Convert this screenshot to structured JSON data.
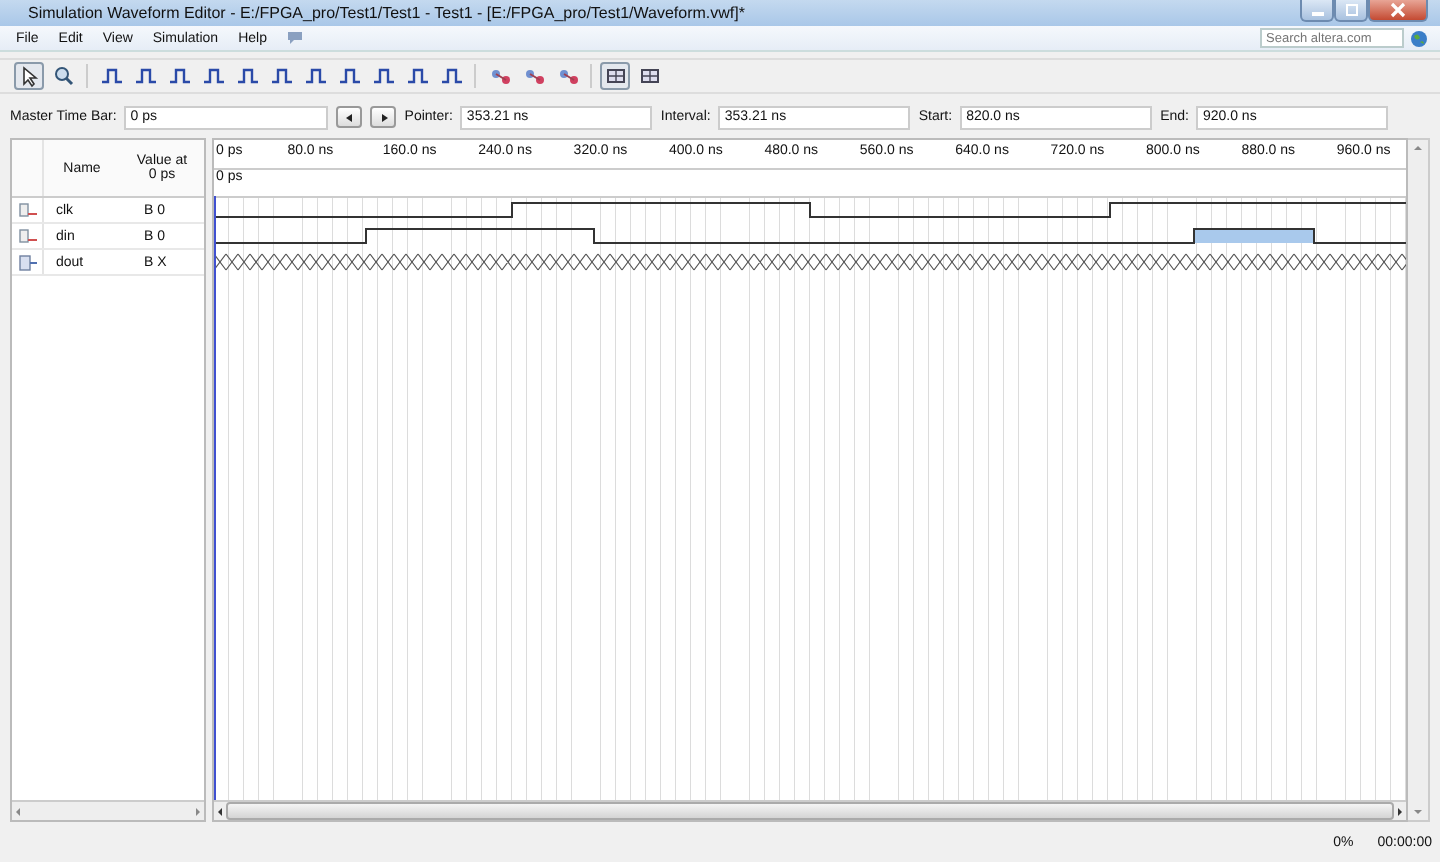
{
  "window": {
    "title": "Simulation Waveform Editor - E:/FPGA_pro/Test1/Test1 - Test1 - [E:/FPGA_pro/Test1/Waveform.vwf]*"
  },
  "menu": [
    "File",
    "Edit",
    "View",
    "Simulation",
    "Help"
  ],
  "search": {
    "placeholder": "Search altera.com"
  },
  "toolbar": [
    {
      "kind": "pointer",
      "pressed": true
    },
    {
      "kind": "zoom",
      "pressed": false
    },
    {
      "kind": "wave",
      "pressed": false
    },
    {
      "kind": "wave",
      "pressed": false
    },
    {
      "kind": "wave",
      "pressed": false
    },
    {
      "kind": "wave",
      "pressed": false
    },
    {
      "kind": "wave",
      "pressed": false
    },
    {
      "kind": "wave",
      "pressed": false
    },
    {
      "kind": "wave",
      "pressed": false
    },
    {
      "kind": "wave",
      "pressed": false
    },
    {
      "kind": "wave",
      "pressed": false
    },
    {
      "kind": "wave",
      "pressed": false
    },
    {
      "kind": "wave",
      "pressed": false
    },
    {
      "kind": "node",
      "pressed": false
    },
    {
      "kind": "node",
      "pressed": false
    },
    {
      "kind": "node",
      "pressed": false
    },
    {
      "kind": "grid",
      "pressed": true
    },
    {
      "kind": "grid",
      "pressed": false
    }
  ],
  "time_bar": {
    "master_label": "Master Time Bar:",
    "master_value": "0 ps",
    "fields": [
      {
        "label": "Pointer:",
        "value": "353.21 ns"
      },
      {
        "label": "Interval:",
        "value": "353.21 ns"
      },
      {
        "label": "Start:",
        "value": "820.0 ns"
      },
      {
        "label": "End:",
        "value": "920.0 ns"
      }
    ]
  },
  "columns": [
    "Name",
    "Value at\n0 ps"
  ],
  "ruler": [
    "0 ps",
    "80.0 ns",
    "160.0 ns",
    "240.0 ns",
    "320.0 ns",
    "400.0 ns",
    "480.0 ns",
    "560.0 ns",
    "640.0 ns",
    "720.0 ns",
    "800.0 ns",
    "880.0 ns",
    "960.0 ns"
  ],
  "cursor_label": "0 ps",
  "signals": [
    {
      "name": "clk",
      "value": "B 0",
      "kind": "input"
    },
    {
      "name": "din",
      "value": "B 0",
      "kind": "input"
    },
    {
      "name": "dout",
      "value": "B X",
      "kind": "output"
    }
  ],
  "status_bar": {
    "progress": "0%",
    "time": "00:00:00"
  }
}
